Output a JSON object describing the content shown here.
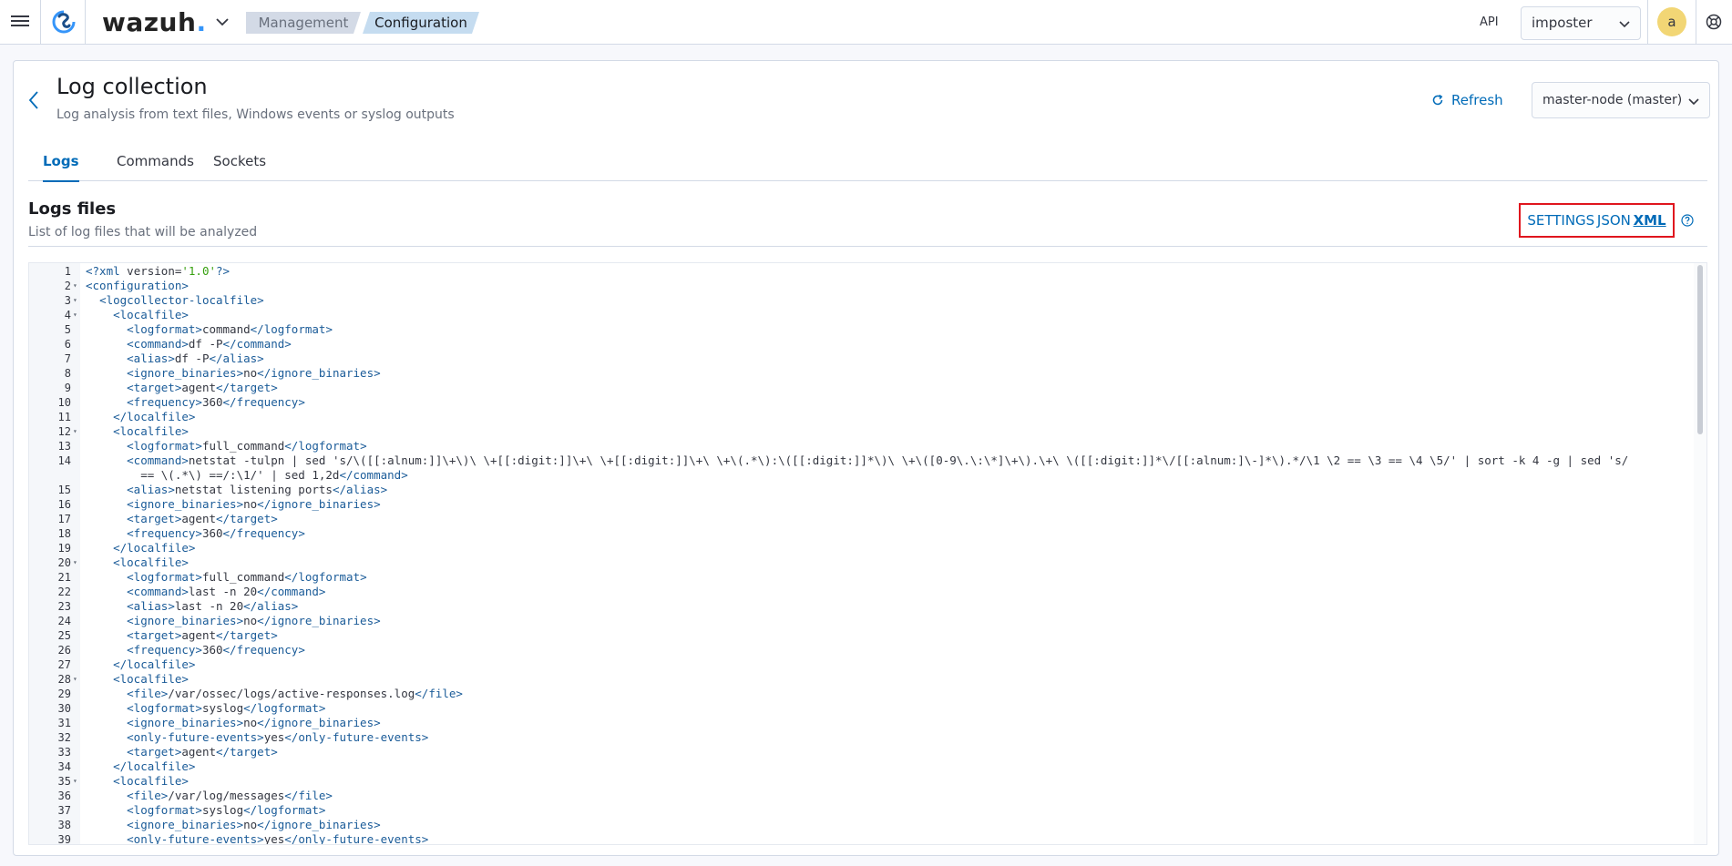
{
  "header": {
    "brand_name": "wazuh",
    "brand_dot": ".",
    "breadcrumb_parent": "Management",
    "breadcrumb_current": "Configuration",
    "api_label": "API",
    "api_selected": "imposter",
    "avatar_letter": "a"
  },
  "page": {
    "title": "Log collection",
    "subtitle": "Log analysis from text files, Windows events or syslog outputs",
    "refresh_label": "Refresh",
    "node_selected": "master-node (master)"
  },
  "tabs": [
    {
      "label": "Logs",
      "selected": true
    },
    {
      "label": "Commands",
      "selected": false
    },
    {
      "label": "Sockets",
      "selected": false
    }
  ],
  "section": {
    "title": "Logs files",
    "subtitle": "List of log files that will be analyzed",
    "format_settings": "SETTINGS",
    "format_json": "JSON",
    "format_xml": "XML"
  },
  "colors": {
    "accent": "#006bb8",
    "highlight_border": "#e0161e",
    "avatar_bg": "#f2d675"
  },
  "code": {
    "lines": [
      {
        "n": "1",
        "fold": false,
        "text": "<?xml version='1.0'?>"
      },
      {
        "n": "2",
        "fold": true,
        "text": "<configuration>"
      },
      {
        "n": "3",
        "fold": true,
        "text": "  <logcollector-localfile>"
      },
      {
        "n": "4",
        "fold": true,
        "text": "    <localfile>"
      },
      {
        "n": "5",
        "fold": false,
        "text": "      <logformat>command</logformat>"
      },
      {
        "n": "6",
        "fold": false,
        "text": "      <command>df -P</command>"
      },
      {
        "n": "7",
        "fold": false,
        "text": "      <alias>df -P</alias>"
      },
      {
        "n": "8",
        "fold": false,
        "text": "      <ignore_binaries>no</ignore_binaries>"
      },
      {
        "n": "9",
        "fold": false,
        "text": "      <target>agent</target>"
      },
      {
        "n": "10",
        "fold": false,
        "text": "      <frequency>360</frequency>"
      },
      {
        "n": "11",
        "fold": false,
        "text": "    </localfile>"
      },
      {
        "n": "12",
        "fold": true,
        "text": "    <localfile>"
      },
      {
        "n": "13",
        "fold": false,
        "text": "      <logformat>full_command</logformat>"
      },
      {
        "n": "14",
        "fold": false,
        "wrap": true,
        "text": "      <command>netstat -tulpn | sed 's/\\([[:alnum:]]\\+\\)\\ \\+[[:digit:]]\\+\\ \\+[[:digit:]]\\+\\ \\+\\(.*\\):\\([[:digit:]]*\\)\\ \\+\\([0-9\\.\\:\\*]\\+\\).\\+\\ \\([[:digit:]]*\\/[[:alnum:]\\-]*\\).*/\\1 \\2 == \\3 == \\4 \\5/' | sort -k 4 -g | sed 's/\n        == \\(.*\\) ==/:\\1/' | sed 1,2d</command>"
      },
      {
        "n": "15",
        "fold": false,
        "text": "      <alias>netstat listening ports</alias>"
      },
      {
        "n": "16",
        "fold": false,
        "text": "      <ignore_binaries>no</ignore_binaries>"
      },
      {
        "n": "17",
        "fold": false,
        "text": "      <target>agent</target>"
      },
      {
        "n": "18",
        "fold": false,
        "text": "      <frequency>360</frequency>"
      },
      {
        "n": "19",
        "fold": false,
        "text": "    </localfile>"
      },
      {
        "n": "20",
        "fold": true,
        "text": "    <localfile>"
      },
      {
        "n": "21",
        "fold": false,
        "text": "      <logformat>full_command</logformat>"
      },
      {
        "n": "22",
        "fold": false,
        "text": "      <command>last -n 20</command>"
      },
      {
        "n": "23",
        "fold": false,
        "text": "      <alias>last -n 20</alias>"
      },
      {
        "n": "24",
        "fold": false,
        "text": "      <ignore_binaries>no</ignore_binaries>"
      },
      {
        "n": "25",
        "fold": false,
        "text": "      <target>agent</target>"
      },
      {
        "n": "26",
        "fold": false,
        "text": "      <frequency>360</frequency>"
      },
      {
        "n": "27",
        "fold": false,
        "text": "    </localfile>"
      },
      {
        "n": "28",
        "fold": true,
        "text": "    <localfile>"
      },
      {
        "n": "29",
        "fold": false,
        "text": "      <file>/var/ossec/logs/active-responses.log</file>"
      },
      {
        "n": "30",
        "fold": false,
        "text": "      <logformat>syslog</logformat>"
      },
      {
        "n": "31",
        "fold": false,
        "text": "      <ignore_binaries>no</ignore_binaries>"
      },
      {
        "n": "32",
        "fold": false,
        "text": "      <only-future-events>yes</only-future-events>"
      },
      {
        "n": "33",
        "fold": false,
        "text": "      <target>agent</target>"
      },
      {
        "n": "34",
        "fold": false,
        "text": "    </localfile>"
      },
      {
        "n": "35",
        "fold": true,
        "text": "    <localfile>"
      },
      {
        "n": "36",
        "fold": false,
        "text": "      <file>/var/log/messages</file>"
      },
      {
        "n": "37",
        "fold": false,
        "text": "      <logformat>syslog</logformat>"
      },
      {
        "n": "38",
        "fold": false,
        "text": "      <ignore_binaries>no</ignore_binaries>"
      },
      {
        "n": "39",
        "fold": false,
        "text": "      <only-future-events>yes</only-future-events>"
      }
    ]
  }
}
